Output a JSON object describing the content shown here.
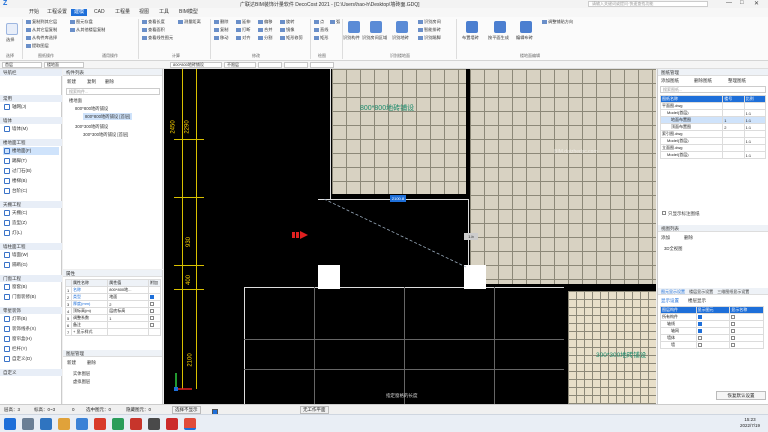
{
  "title_bar": {
    "title": "广联达BIM装饰计量软件 DecoCost 2021 - [C:\\Users\\hao-h\\Desktop\\墙砖面.GDQ]",
    "search_placeholder": "请输入关键词或提问·快速查找功能",
    "minimize": "—",
    "maximize": "□",
    "close": "✕"
  },
  "menu": {
    "tabs": [
      "开始",
      "工程设置",
      "建模",
      "CAD",
      "工程量",
      "视图",
      "工具",
      "BIM模型"
    ],
    "active_tab": "建模"
  },
  "ribbon": {
    "select_label": "选择",
    "buttons": {
      "copy_to_floor": "复制到其它层",
      "from_other_floor": "从其它层复制",
      "set_components": "图元存盘",
      "component_lib": "从其他楼层复制",
      "auto_layout": "从构件库选择",
      "extract_layer": "提取图层",
      "query_length": "查看长度",
      "query_area": "查看面积",
      "query_properties": "查看线性图元",
      "query_distance": "测量距离",
      "edit": "偏移",
      "merge": "合并",
      "split": "分割",
      "rotate": "旋转",
      "mirror": "镜像",
      "trim": "矩形修剪",
      "align": "对齐",
      "delete": "删除",
      "copy": "复制",
      "move": "移动",
      "extend": "延伸",
      "break": "打断",
      "point": "点",
      "line": "直线",
      "rect": "矩形",
      "arc": "弧",
      "draw_add": "智能布置",
      "recognize_component": "识别构件",
      "recognize_room": "识别房间区域",
      "recognize_tile": "识别地砖",
      "recognize_room2": "识别房间",
      "smart_layout": "智能排砖",
      "smart_segment": "识别踢脚",
      "layout_plan": "布置墙砖",
      "switch_plan": "按平面生成",
      "edit_tile": "编辑布砖",
      "adjust_direction": "调整铺贴方向"
    },
    "groups": [
      "选择",
      "图纸操作",
      "通用操作",
      "计算",
      "修改",
      "绘图",
      "识别楼地面",
      "楼地面编辑"
    ]
  },
  "strip": {
    "floor": "首层",
    "type": "楼地面",
    "component": "800*800地砖铺设",
    "layer": "不限层",
    "combo5": "",
    "combo6": "",
    "combo7": ""
  },
  "nav": {
    "header": "导航栏",
    "groups": [
      {
        "label": "常用",
        "items": [
          {
            "label": "轴网(J)"
          }
        ]
      },
      {
        "label": "墙体",
        "items": [
          {
            "label": "墙体(M)"
          }
        ]
      },
      {
        "label": "楼地面工程",
        "items": [
          {
            "label": "楼地面(F)",
            "selected": true
          },
          {
            "label": "踢脚(T)"
          },
          {
            "label": "过门石(B)"
          },
          {
            "label": "楼梯(B)"
          },
          {
            "label": "台阶(C)"
          }
        ]
      },
      {
        "label": "天棚工程",
        "items": [
          {
            "label": "天棚(C)"
          },
          {
            "label": "造型(Z)"
          },
          {
            "label": "灯(L)"
          }
        ]
      },
      {
        "label": "墙柱面工程",
        "items": [
          {
            "label": "墙面(W)"
          },
          {
            "label": "隔断(G)"
          }
        ]
      },
      {
        "label": "门窗工程",
        "items": [
          {
            "label": "窗套(B)"
          },
          {
            "label": "门窗装修(B)"
          }
        ]
      },
      {
        "label": "零星装饰",
        "items": [
          {
            "label": "灯带(B)"
          },
          {
            "label": "装饰线条(X)"
          },
          {
            "label": "窗帘盒(H)"
          },
          {
            "label": "栏杆(Y)"
          },
          {
            "label": "自定义(D)"
          }
        ]
      },
      {
        "label": "自定义",
        "items": []
      }
    ]
  },
  "component_list": {
    "header": "构件列表",
    "new_label": "新建",
    "copy_label": "复制",
    "delete_label": "删除",
    "search_placeholder": "搜索构件...",
    "tree": [
      {
        "label": "楼地面",
        "level": 0
      },
      {
        "label": "800*800地砖铺设",
        "level": 1
      },
      {
        "label": "800*800地砖铺设 [首层]",
        "level": 2,
        "selected": true
      },
      {
        "label": "300*300地砖铺设",
        "level": 1
      },
      {
        "label": "300*300地砖铺设 [首层]",
        "level": 2
      }
    ]
  },
  "properties": {
    "header": "属性",
    "columns": [
      "属性名称",
      "属性值",
      "附加"
    ],
    "rows": [
      {
        "n": "1",
        "name": "名称",
        "value": "800*800地...",
        "checked": null
      },
      {
        "n": "2",
        "name": "类型",
        "value": "地面",
        "checked": true
      },
      {
        "n": "3",
        "name": "厚度(mm)",
        "value": "2",
        "checked": false
      },
      {
        "n": "4",
        "name": "顶标高(m)",
        "value": "层底标高",
        "checked": false
      },
      {
        "n": "5",
        "name": "调整系数",
        "value": "1",
        "checked": false
      },
      {
        "n": "6",
        "name": "备注",
        "value": "",
        "checked": false
      },
      {
        "n": "7",
        "name": "+ 显示样式",
        "value": "",
        "checked": null
      }
    ]
  },
  "layers": {
    "header": "图层管理",
    "new_label": "新建",
    "delete_label": "删除",
    "items": [
      "实体图层",
      "虚拟图层"
    ]
  },
  "canvas": {
    "label_800": "800*800地砖铺设",
    "label_300": "300*300地砖铺设",
    "dims": [
      "2450",
      "2290",
      "930",
      "400",
      "2100"
    ],
    "dim_box": "2100.8",
    "small_tag": "1.b",
    "hint": "指定窗格的长度",
    "watermark": "BIM.daizhedsc.com"
  },
  "right_panel": {
    "drawing_mgmt": {
      "header": "图纸管理",
      "buttons": [
        "添加图纸",
        "删除图纸",
        "整理图纸"
      ],
      "search_placeholder": "搜索图纸...",
      "columns": [
        "图纸名称",
        "楼号",
        "比例"
      ],
      "rows": [
        {
          "name": "平面图.dwg",
          "floor": "",
          "scale": ""
        },
        {
          "name": "Model(首层)",
          "floor": "",
          "scale": "1:1"
        },
        {
          "name": "地面布置图",
          "floor": "1",
          "scale": "1:1",
          "selected": true
        },
        {
          "name": "顶面布置图",
          "floor": "2",
          "scale": "1:1"
        },
        {
          "name": "索引图.dwg",
          "floor": "",
          "scale": ""
        },
        {
          "name": "Model(首层)",
          "floor": "",
          "scale": "1:1"
        },
        {
          "name": "立面图.dwg",
          "floor": "",
          "scale": ""
        },
        {
          "name": "Model(首层)",
          "floor": "",
          "scale": "1:1"
        }
      ],
      "checkbox": "只显示标注图纸"
    },
    "view_list": {
      "header": "视图列表",
      "add": "添加",
      "delete": "删除",
      "item": "3D全视图"
    },
    "display_settings": {
      "tabs": [
        "图元显示设置",
        "楼层显示设置",
        "三维图纸显示设置"
      ],
      "sub_tabs": [
        "显示设置",
        "楼层显示"
      ],
      "columns": [
        "图层构件",
        "显示图元",
        "显示名称"
      ],
      "rows": [
        "所有构件",
        "轴线",
        "轴网",
        "墙体",
        "墙"
      ],
      "footer": "恢复默认设置"
    }
  },
  "status_bar": {
    "floor_height": "层高：3",
    "base_height": "标高：0~3",
    "hidden": "0",
    "selected_count": "选中图元：0",
    "hidden_count": "隐藏图元：0",
    "cross_select": "选择不显示",
    "mode": "正交",
    "layer_plane": "无工作平面"
  },
  "taskbar": {
    "time": "15:23",
    "date": "2022/7/19"
  },
  "colors": {
    "accent": "#1e6fd9",
    "canvas_bg": "#000000",
    "cad_yellow": "#ffd400",
    "tile_label": "#1a8a6b"
  }
}
